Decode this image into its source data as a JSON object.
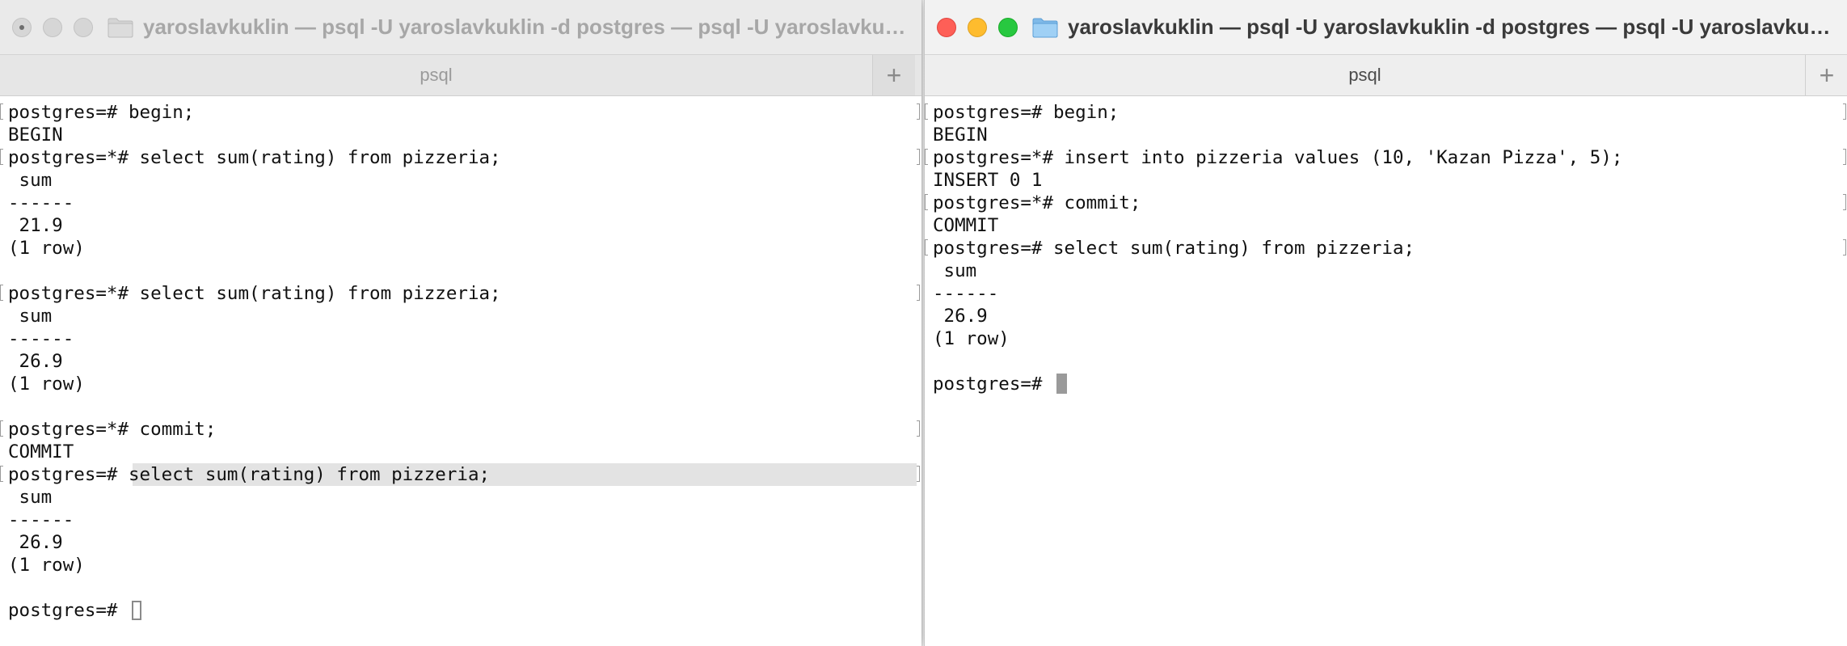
{
  "windows": [
    {
      "id": "left",
      "title": "yaroslavkuklin — psql -U yaroslavkuklin -d postgres — psql -U yaroslavkuklin -d postgres",
      "tab_label": "psql",
      "new_tab_glyph": "+",
      "active": false,
      "lines": [
        {
          "text": "postgres=# begin;",
          "marked": true
        },
        {
          "text": "BEGIN",
          "marked": false
        },
        {
          "text": "postgres=*# select sum(rating) from pizzeria;",
          "marked": true
        },
        {
          "text": " sum",
          "marked": false
        },
        {
          "text": "------",
          "marked": false
        },
        {
          "text": " 21.9",
          "marked": false
        },
        {
          "text": "(1 row)",
          "marked": false
        },
        {
          "text": "",
          "marked": false
        },
        {
          "text": "postgres=*# select sum(rating) from pizzeria;",
          "marked": true
        },
        {
          "text": " sum",
          "marked": false
        },
        {
          "text": "------",
          "marked": false
        },
        {
          "text": " 26.9",
          "marked": false
        },
        {
          "text": "(1 row)",
          "marked": false
        },
        {
          "text": "",
          "marked": false
        },
        {
          "text": "postgres=*# commit;",
          "marked": true
        },
        {
          "text": "COMMIT",
          "marked": false
        },
        {
          "text": "postgres=# select sum(rating) from pizzeria;",
          "marked": true,
          "selected": true
        },
        {
          "text": " sum",
          "marked": false
        },
        {
          "text": "------",
          "marked": false
        },
        {
          "text": " 26.9",
          "marked": false
        },
        {
          "text": "(1 row)",
          "marked": false
        },
        {
          "text": "",
          "marked": false
        },
        {
          "text": "postgres=# ",
          "marked": false,
          "cursor": "hollow"
        }
      ]
    },
    {
      "id": "right",
      "title": "yaroslavkuklin — psql -U yaroslavkuklin -d postgres — psql -U yaroslavkuklin -d postgres",
      "tab_label": "psql",
      "new_tab_glyph": "+",
      "active": true,
      "lines": [
        {
          "text": "postgres=# begin;",
          "marked": true
        },
        {
          "text": "BEGIN",
          "marked": false
        },
        {
          "text": "postgres=*# insert into pizzeria values (10, 'Kazan Pizza', 5);",
          "marked": true
        },
        {
          "text": "INSERT 0 1",
          "marked": false
        },
        {
          "text": "postgres=*# commit;",
          "marked": true
        },
        {
          "text": "COMMIT",
          "marked": false
        },
        {
          "text": "postgres=# select sum(rating) from pizzeria;",
          "marked": true
        },
        {
          "text": " sum",
          "marked": false
        },
        {
          "text": "------",
          "marked": false
        },
        {
          "text": " 26.9",
          "marked": false
        },
        {
          "text": "(1 row)",
          "marked": false
        },
        {
          "text": "",
          "marked": false
        },
        {
          "text": "postgres=# ",
          "marked": false,
          "cursor": "solid"
        }
      ]
    }
  ],
  "colors": {
    "close": "#fe5f57",
    "minimize": "#febc2e",
    "zoom": "#28c840",
    "folder": "#8fc6f0"
  },
  "icons": {
    "folder": "folder-icon",
    "new_tab": "plus-icon"
  }
}
